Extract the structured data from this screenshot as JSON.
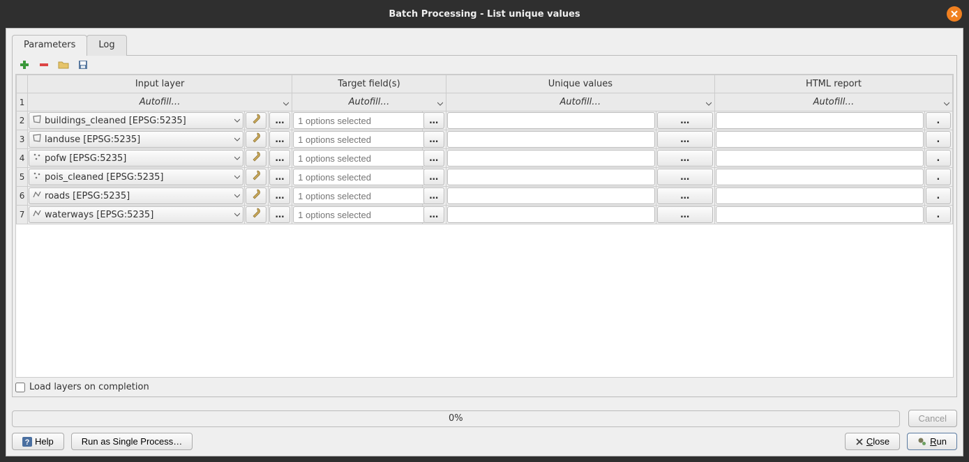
{
  "window": {
    "title": "Batch Processing - List unique values"
  },
  "tabs": {
    "parameters": "Parameters",
    "log": "Log"
  },
  "columns": {
    "input_layer": "Input layer",
    "target_fields": "Target field(s)",
    "unique_values": "Unique values",
    "html_report": "HTML report"
  },
  "autofill": "Autofill…",
  "ellipsis": "…",
  "target_placeholder": "1 options selected",
  "rows": [
    {
      "num": "2",
      "layer": "buildings_cleaned [EPSG:5235]",
      "geom": "polygon"
    },
    {
      "num": "3",
      "layer": "landuse [EPSG:5235]",
      "geom": "polygon"
    },
    {
      "num": "4",
      "layer": "pofw [EPSG:5235]",
      "geom": "point"
    },
    {
      "num": "5",
      "layer": "pois_cleaned [EPSG:5235]",
      "geom": "point"
    },
    {
      "num": "6",
      "layer": "roads [EPSG:5235]",
      "geom": "line"
    },
    {
      "num": "7",
      "layer": "waterways [EPSG:5235]",
      "geom": "line"
    }
  ],
  "checkbox": {
    "label": "Load layers on completion"
  },
  "progress": {
    "text": "0%"
  },
  "buttons": {
    "cancel": "Cancel",
    "help": "Help",
    "single": "Run as Single Process…",
    "close": "Close",
    "run": "Run"
  }
}
